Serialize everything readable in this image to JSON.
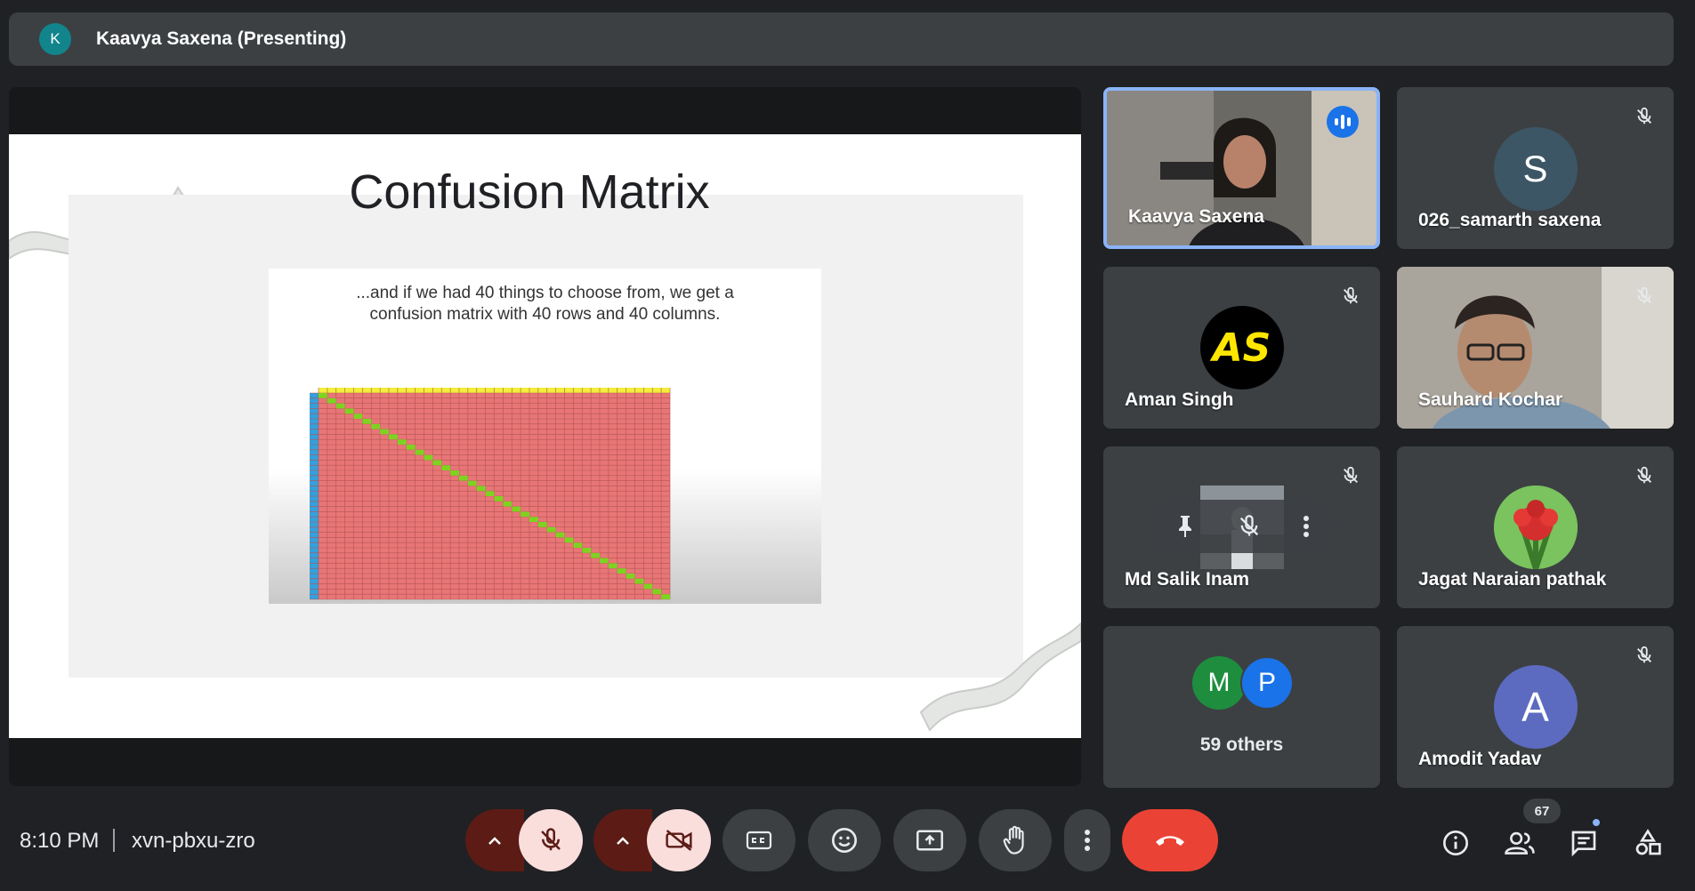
{
  "presenter": {
    "initial": "K",
    "label": "Kaavya Saxena (Presenting)"
  },
  "slide": {
    "title": "Confusion Matrix",
    "caption_lines": [
      "...and if we had 40 things to choose from, we get a",
      "confusion matrix with 40 rows and 40 columns."
    ],
    "matrix": {
      "rows": 40,
      "columns": 40
    }
  },
  "participants": [
    {
      "name": "Kaavya Saxena",
      "type": "video",
      "speaking": true,
      "muted": false
    },
    {
      "name": "026_samarth saxena",
      "type": "avatar",
      "initial": "S",
      "color": "#3c5666",
      "muted": true
    },
    {
      "name": "Aman Singh",
      "type": "logo",
      "logo_text": "AS",
      "muted": true
    },
    {
      "name": "Sauhard Kochar",
      "type": "video",
      "muted": true
    },
    {
      "name": "Md Salik Inam",
      "type": "photo",
      "muted": true
    },
    {
      "name": "Jagat Naraian pathak",
      "type": "photo",
      "muted": true
    },
    {
      "name": "59 others",
      "type": "group",
      "initials": [
        "M",
        "P"
      ],
      "colors": [
        "#1e8e3e",
        "#1a73e8"
      ]
    },
    {
      "name": "Amodit Yadav",
      "type": "avatar",
      "initial": "A",
      "color": "#5c6bc0",
      "muted": true
    }
  ],
  "bottom": {
    "time": "8:10 PM",
    "meeting_code": "xvn-pbxu-zro",
    "participants_count": "67"
  },
  "colors": {
    "mic_off_bg": "#f9dedc",
    "end_call": "#ea4335",
    "speaking_border": "#8ab4f8"
  }
}
